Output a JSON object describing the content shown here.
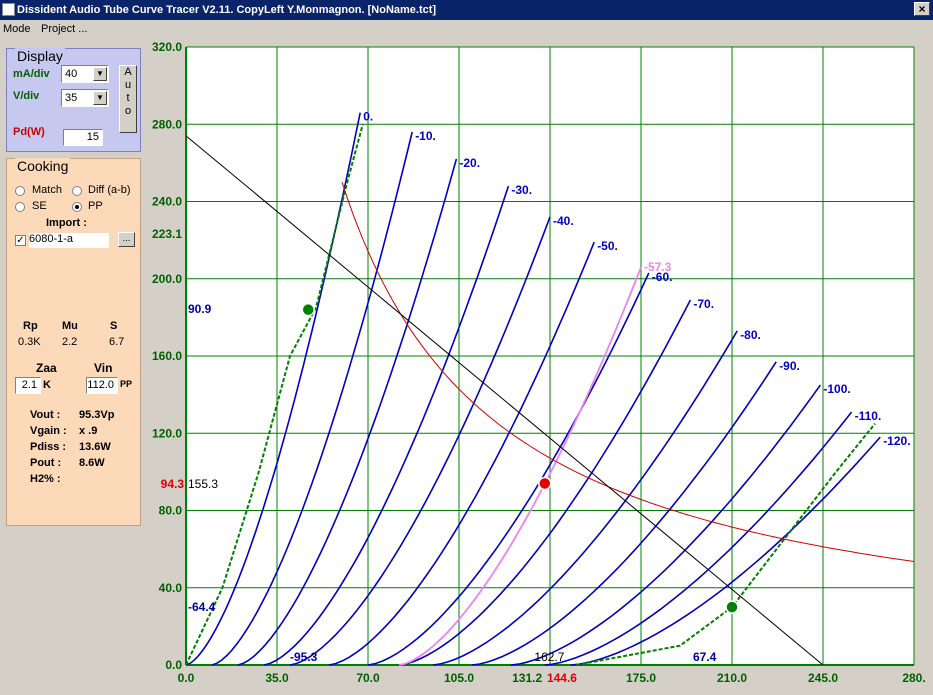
{
  "window": {
    "title": "Dissident Audio Tube Curve Tracer V2.11. CopyLeft Y.Monmagnon. [NoName.tct]",
    "close_glyph": "×"
  },
  "menu": [
    "Mode",
    "Project ..."
  ],
  "display": {
    "legend": "Display",
    "ma_label": "mA/div",
    "ma_value": "40",
    "v_label": "V/div",
    "v_value": "35",
    "auto_letters": [
      "A",
      "u",
      "t",
      "o"
    ],
    "pd_label": "Pd(W)",
    "pd_value": "15"
  },
  "cooking": {
    "legend": "Cooking",
    "radios": [
      {
        "label": "Match",
        "checked": false
      },
      {
        "label": "Diff (a-b)",
        "checked": false
      },
      {
        "label": "SE",
        "checked": false
      },
      {
        "label": "PP",
        "checked": true
      }
    ],
    "import_label": "Import :",
    "import_file": "6080-1-a",
    "import_checked": true,
    "browse_label": "...",
    "params_headers": [
      "Rp",
      "Mu",
      "S"
    ],
    "params_values": [
      "0.3K",
      "2.2",
      "6.7"
    ],
    "zaa_label": "Zaa",
    "vin_label": "Vin",
    "zaa_value": "2.1",
    "zaa_unit": "K",
    "vin_value": "112.0",
    "vin_unit": "PP",
    "results": [
      {
        "label": "Vout :",
        "value": "95.3Vp"
      },
      {
        "label": "Vgain :",
        "value": "x .9"
      },
      {
        "label": "Pdiss :",
        "value": "13.6W"
      },
      {
        "label": "Pout :",
        "value": "8.6W"
      },
      {
        "label": "H2% :",
        "value": ""
      }
    ]
  },
  "colors": {
    "grid": "#008000",
    "curves": "#0000c0",
    "load_line": "#000000",
    "pd_hyperbola": "#d00000",
    "highlight_curve": "#ee82ee",
    "swing_curve": "#008000"
  },
  "chart_data": {
    "type": "line",
    "x_ticks": [
      "0.0",
      "35.0",
      "70.0",
      "105.0",
      "131.2",
      "144.6",
      "175.0",
      "210.0",
      "245.0",
      "280."
    ],
    "y_ticks": [
      "0.0",
      "40.0",
      "80.0",
      "120.0",
      "160.0",
      "200.0",
      "223.1",
      "240.0",
      "280.0",
      "320.0"
    ],
    "xlim": [
      0,
      280
    ],
    "ylim": [
      0,
      320
    ],
    "grid": true,
    "grid_labels": [
      "0.",
      "-10.",
      "-20.",
      "-30.",
      "-40.",
      "-50.",
      "-60.",
      "-70.",
      "-80.",
      "-90.",
      "-100.",
      "-110.",
      "-120."
    ],
    "grid_curves_ends": [
      [
        67,
        286
      ],
      [
        87,
        276
      ],
      [
        104,
        262
      ],
      [
        124,
        248
      ],
      [
        140,
        232
      ],
      [
        157,
        219
      ],
      [
        178,
        203
      ],
      [
        194,
        189
      ],
      [
        212,
        173
      ],
      [
        227,
        157
      ],
      [
        244,
        145
      ],
      [
        256,
        131
      ],
      [
        267,
        118
      ]
    ],
    "grid_curves_starts": [
      0,
      10,
      20,
      30,
      40,
      55,
      70,
      82,
      95,
      110,
      125,
      138,
      148
    ],
    "highlight_curve": {
      "label": "-57.3",
      "start": 82,
      "end": [
        175,
        206
      ]
    },
    "swing_curve_pts": [
      [
        0,
        0
      ],
      [
        14,
        40
      ],
      [
        28,
        100
      ],
      [
        40,
        160
      ],
      [
        50,
        185
      ],
      [
        62,
        250
      ],
      [
        68,
        280
      ]
    ],
    "swing_curve_pts_b": [
      [
        150,
        0
      ],
      [
        190,
        10
      ],
      [
        210,
        30
      ],
      [
        230,
        65
      ],
      [
        250,
        100
      ],
      [
        265,
        125
      ]
    ],
    "load_line": {
      "from": [
        0,
        274
      ],
      "to": [
        245,
        0
      ]
    },
    "pd_watts": 15,
    "points": [
      {
        "x": 47,
        "y": 184,
        "color": "#008000"
      },
      {
        "x": 138,
        "y": 94,
        "color": "#e00000"
      },
      {
        "x": 210,
        "y": 30,
        "color": "#008000"
      }
    ],
    "annotations": [
      {
        "text": "90.9",
        "color": "#0000a0"
      },
      {
        "text": "94.3",
        "color": "#e00000"
      },
      {
        "text": "155.3",
        "color": "#000000"
      },
      {
        "text": "-64.4",
        "color": "#0000a0"
      },
      {
        "text": "-95.3",
        "color": "#0000a0"
      },
      {
        "text": "162.7",
        "color": "#000000"
      },
      {
        "text": "67.4",
        "color": "#0000a0"
      }
    ]
  }
}
